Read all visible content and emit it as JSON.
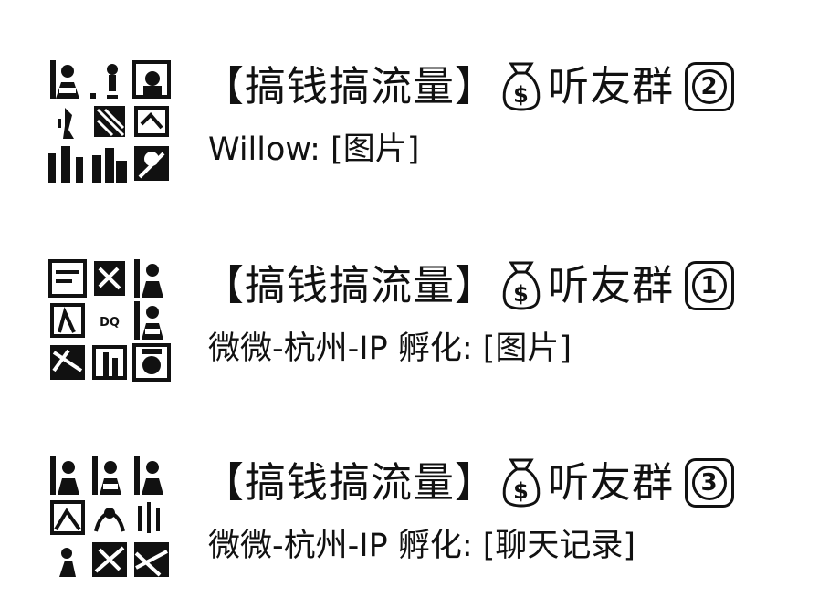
{
  "chats": [
    {
      "title": "【搞钱搞流量】",
      "group_name": "听友群",
      "badge_number": "2",
      "icon": "money-bag-icon",
      "preview": "Willow: [图片]"
    },
    {
      "title": "【搞钱搞流量】",
      "group_name": "听友群",
      "badge_number": "1",
      "icon": "money-bag-icon",
      "preview": "微微-杭州-IP 孵化: [图片]"
    },
    {
      "title": "【搞钱搞流量】",
      "group_name": "听友群",
      "badge_number": "3",
      "icon": "money-bag-icon",
      "preview": "微微-杭州-IP 孵化: [聊天记录]"
    }
  ]
}
